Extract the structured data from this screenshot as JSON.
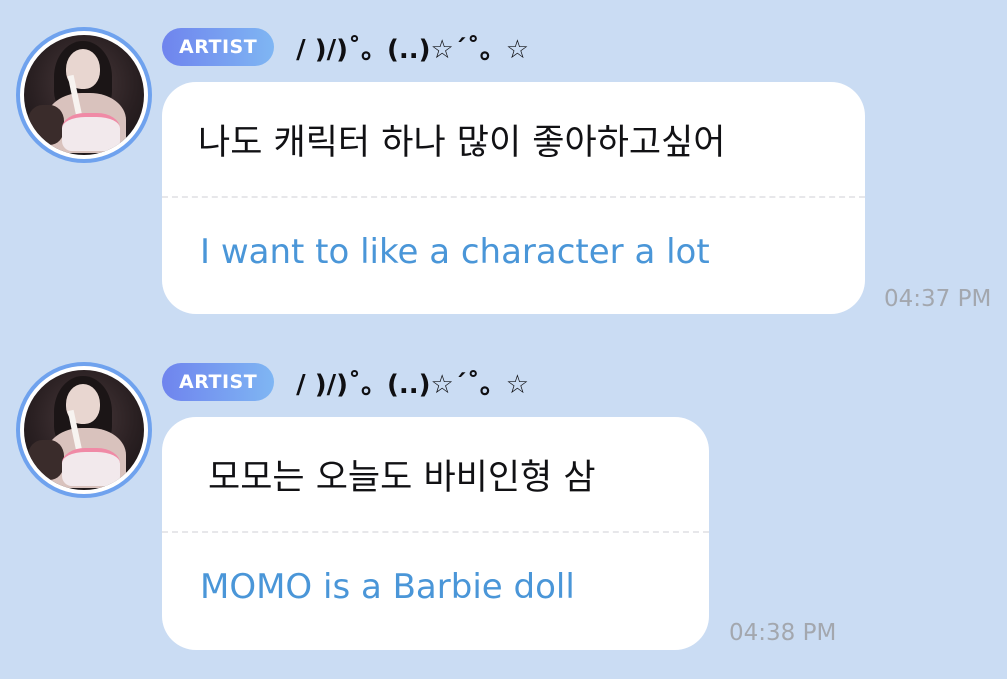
{
  "messages": [
    {
      "badge": "ARTIST",
      "nickname": "/ )/)˚。(..)☆´˚。☆",
      "korean": "나도 캐릭터 하나 많이 좋아하고싶어",
      "translation": "I want to like a character a lot",
      "time": "04:37 PM"
    },
    {
      "badge": "ARTIST",
      "nickname": "/ )/)˚。(..)☆´˚。☆",
      "korean": "모모는 오늘도 바비인형 삼",
      "translation": "MOMO is a Barbie doll",
      "time": "04:38 PM"
    }
  ],
  "colors": {
    "background": "#cadcf3",
    "badge_gradient_start": "#6f84ee",
    "badge_gradient_end": "#7fb6f3",
    "translation_text": "#4a96d8",
    "timestamp": "#a3a7ae",
    "avatar_ring": "#6fa2ee"
  }
}
